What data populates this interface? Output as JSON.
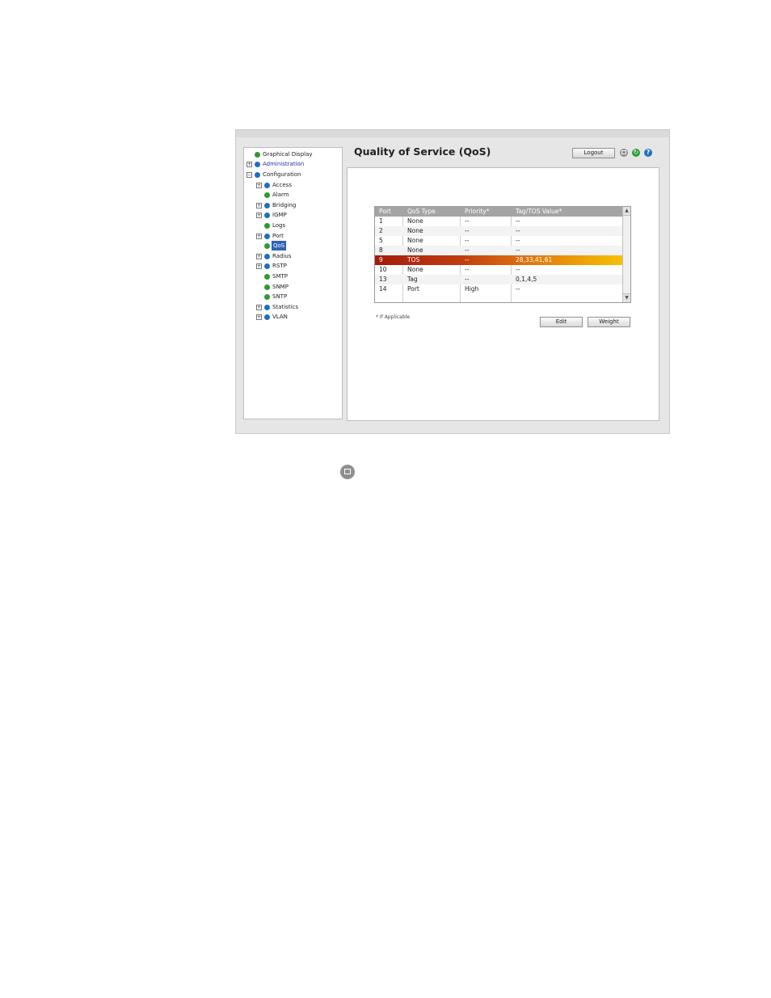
{
  "nav": {
    "items": [
      {
        "label": "Graphical Display",
        "bullet": "green",
        "expander": ""
      },
      {
        "label": "Administration",
        "bullet": "blue",
        "expander": "+"
      },
      {
        "label": "Configuration",
        "bullet": "blue",
        "expander": "−"
      },
      {
        "label": "Access",
        "bullet": "blue",
        "expander": "+"
      },
      {
        "label": "Alarm",
        "bullet": "green",
        "expander": ""
      },
      {
        "label": "Bridging",
        "bullet": "blue",
        "expander": "+"
      },
      {
        "label": "IGMP",
        "bullet": "blue",
        "expander": "+"
      },
      {
        "label": "Logs",
        "bullet": "green",
        "expander": ""
      },
      {
        "label": "Port",
        "bullet": "blue",
        "expander": "+"
      },
      {
        "label": "QoS",
        "bullet": "green",
        "expander": ""
      },
      {
        "label": "Radius",
        "bullet": "blue",
        "expander": "+"
      },
      {
        "label": "RSTP",
        "bullet": "blue",
        "expander": "+"
      },
      {
        "label": "SMTP",
        "bullet": "green",
        "expander": ""
      },
      {
        "label": "SNMP",
        "bullet": "green",
        "expander": ""
      },
      {
        "label": "SNTP",
        "bullet": "green",
        "expander": ""
      },
      {
        "label": "Statistics",
        "bullet": "blue",
        "expander": "+"
      },
      {
        "label": "VLAN",
        "bullet": "blue",
        "expander": "+"
      }
    ]
  },
  "main": {
    "title": "Quality of Service (QoS)",
    "logout_label": "Logout",
    "refresh_glyph": "↻",
    "help_glyph": "?",
    "table": {
      "headers": [
        "Port",
        "QoS Type",
        "Priority*",
        "Tag/TOS Value*"
      ],
      "rows": [
        [
          "1",
          "None",
          "--",
          "--"
        ],
        [
          "2",
          "None",
          "--",
          "--"
        ],
        [
          "5",
          "None",
          "--",
          "--"
        ],
        [
          "8",
          "None",
          "--",
          "--"
        ],
        [
          "9",
          "TOS",
          "--",
          "28,33,41,61"
        ],
        [
          "10",
          "None",
          "--",
          "--"
        ],
        [
          "13",
          "Tag",
          "--",
          "0,1,4,5"
        ],
        [
          "14",
          "Port",
          "High",
          "--"
        ]
      ],
      "selected_row": 4,
      "scroll_up": "▲",
      "scroll_down": "▼"
    },
    "footnote": "* If Applicable",
    "edit_label": "Edit",
    "weight_label": "Weight"
  },
  "colors": {
    "highlight_start": "#a31a0d",
    "highlight_end": "#f6c100",
    "header_bg": "#a4a4a4",
    "nav_selected": "#2d62b8"
  },
  "icons": [
    "save-icon",
    "refresh-icon",
    "help-icon"
  ]
}
